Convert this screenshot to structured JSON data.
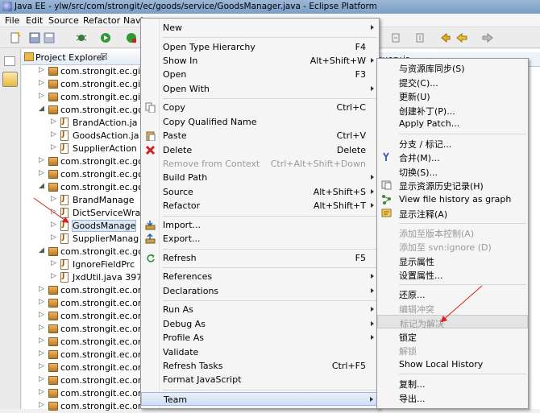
{
  "window": {
    "title": "Java EE - ylw/src/com/strongit/ec/goods/service/GoodsManager.java - Eclipse Platform"
  },
  "menubar": [
    "File",
    "Edit",
    "Source",
    "Refactor",
    "Navi"
  ],
  "explorer": {
    "tab_label": "Project Explorer",
    "tab_close": "☒",
    "rows": [
      {
        "label": "com.strongit.ec.gi",
        "kind": "pkg",
        "arrow": "▷"
      },
      {
        "label": "com.strongit.ec.gi",
        "kind": "pkg",
        "arrow": "▷"
      },
      {
        "label": "com.strongit.ec.gi",
        "kind": "pkg",
        "arrow": "▷"
      },
      {
        "label": "com.strongit.ec.gc",
        "kind": "pkg",
        "arrow": "◢"
      },
      {
        "label": "BrandAction.ja",
        "kind": "java",
        "arrow": "▷"
      },
      {
        "label": "GoodsAction.ja",
        "kind": "java",
        "arrow": "▷"
      },
      {
        "label": "SupplierAction",
        "kind": "java",
        "arrow": "▷"
      },
      {
        "label": "com.strongit.ec.gc",
        "kind": "pkg",
        "arrow": "▷"
      },
      {
        "label": "com.strongit.ec.gc",
        "kind": "pkg",
        "arrow": "▷"
      },
      {
        "label": "com.strongit.ec.gc",
        "kind": "pkg",
        "arrow": "◢"
      },
      {
        "label": "BrandManage",
        "kind": "java",
        "arrow": "▷"
      },
      {
        "label": "DictServiceWra",
        "kind": "java",
        "arrow": "▷"
      },
      {
        "label": "GoodsManage",
        "kind": "java",
        "arrow": "▷",
        "selected": true
      },
      {
        "label": "SupplierManag",
        "kind": "java",
        "arrow": "▷"
      },
      {
        "label": "com.strongit.ec.gc",
        "kind": "pkg",
        "arrow": "◢"
      },
      {
        "label": "IgnoreFieldPrc",
        "kind": "java",
        "arrow": "▷"
      },
      {
        "label": "JxdUtil.java 397",
        "kind": "java",
        "arrow": "▷"
      },
      {
        "label": "com.strongit.ec.or",
        "kind": "pkg",
        "arrow": "▷"
      },
      {
        "label": "com.strongit.ec.or",
        "kind": "pkg",
        "arrow": "▷"
      },
      {
        "label": "com.strongit.ec.or",
        "kind": "pkg",
        "arrow": "▷"
      },
      {
        "label": "com.strongit.ec.or",
        "kind": "pkg",
        "arrow": "▷"
      },
      {
        "label": "com.strongit.ec.or",
        "kind": "pkg",
        "arrow": "▷"
      },
      {
        "label": "com.strongit.ec.or",
        "kind": "pkg",
        "arrow": "▷"
      },
      {
        "label": "com.strongit.ec.or",
        "kind": "pkg",
        "arrow": "▷"
      },
      {
        "label": "com.strongit.ec.or",
        "kind": "pkg",
        "arrow": "▷"
      },
      {
        "label": "com.strongit.ec.or",
        "kind": "pkg",
        "arrow": "▷"
      },
      {
        "label": "com.strongit.ec.or",
        "kind": "pkg",
        "arrow": "▷"
      }
    ]
  },
  "editor": {
    "tab_label": "iquery.js"
  },
  "context_menu": {
    "items": [
      {
        "label": "New",
        "shortcut": "",
        "submenu": true
      },
      {
        "sep": true
      },
      {
        "label": "Open Type Hierarchy",
        "shortcut": "F4"
      },
      {
        "label": "Show In",
        "shortcut": "Alt+Shift+W",
        "submenu": true
      },
      {
        "label": "Open",
        "shortcut": "F3"
      },
      {
        "label": "Open With",
        "shortcut": "",
        "submenu": true
      },
      {
        "sep": true
      },
      {
        "label": "Copy",
        "shortcut": "Ctrl+C",
        "icon": "copy-icon"
      },
      {
        "label": "Copy Qualified Name",
        "shortcut": ""
      },
      {
        "label": "Paste",
        "shortcut": "Ctrl+V",
        "icon": "paste-icon"
      },
      {
        "label": "Delete",
        "shortcut": "Delete",
        "icon": "delete-icon"
      },
      {
        "label": "Remove from Context",
        "shortcut": "Ctrl+Alt+Shift+Down",
        "disabled": true
      },
      {
        "label": "Build Path",
        "shortcut": "",
        "submenu": true
      },
      {
        "label": "Source",
        "shortcut": "Alt+Shift+S",
        "submenu": true
      },
      {
        "label": "Refactor",
        "shortcut": "Alt+Shift+T",
        "submenu": true
      },
      {
        "sep": true
      },
      {
        "label": "Import...",
        "shortcut": "",
        "icon": "import-icon"
      },
      {
        "label": "Export...",
        "shortcut": "",
        "icon": "export-icon"
      },
      {
        "sep": true
      },
      {
        "label": "Refresh",
        "shortcut": "F5",
        "icon": "refresh-icon"
      },
      {
        "sep": true
      },
      {
        "label": "References",
        "shortcut": "",
        "submenu": true
      },
      {
        "label": "Declarations",
        "shortcut": "",
        "submenu": true
      },
      {
        "sep": true
      },
      {
        "label": "Run As",
        "shortcut": "",
        "submenu": true
      },
      {
        "label": "Debug As",
        "shortcut": "",
        "submenu": true
      },
      {
        "label": "Profile As",
        "shortcut": "",
        "submenu": true
      },
      {
        "label": "Validate",
        "shortcut": ""
      },
      {
        "label": "Refresh Tasks",
        "shortcut": "Ctrl+F5"
      },
      {
        "label": "Format JavaScript",
        "shortcut": ""
      },
      {
        "sep": true
      },
      {
        "label": "Team",
        "shortcut": "",
        "submenu": true,
        "highlight": true
      }
    ]
  },
  "team_menu": {
    "items": [
      {
        "label": "与资源库同步(S)"
      },
      {
        "label": "提交(C)..."
      },
      {
        "label": "更新(U)"
      },
      {
        "label": "创建补丁(P)..."
      },
      {
        "label": "Apply Patch..."
      },
      {
        "sep": true
      },
      {
        "label": "分支 / 标记..."
      },
      {
        "label": "合并(M)...",
        "icon": "merge-icon"
      },
      {
        "label": "切换(S)..."
      },
      {
        "label": "显示资源历史记录(H)",
        "icon": "history-icon"
      },
      {
        "label": "View file history as graph",
        "icon": "graph-icon"
      },
      {
        "label": "显示注释(A)",
        "icon": "annotate-icon"
      },
      {
        "sep": true
      },
      {
        "label": "添加至版本控制(A)",
        "disabled": true
      },
      {
        "label": "添加至 svn:ignore (D)",
        "disabled": true
      },
      {
        "label": "显示属性"
      },
      {
        "label": "设置属性..."
      },
      {
        "sep": true
      },
      {
        "label": "还原..."
      },
      {
        "label": "编辑冲突",
        "disabled": true
      },
      {
        "label": "标记为解决",
        "disabled": true,
        "hover": true
      },
      {
        "label": "锁定"
      },
      {
        "label": "解锁",
        "disabled": true
      },
      {
        "label": "Show Local History"
      },
      {
        "sep": true
      },
      {
        "label": "复制..."
      },
      {
        "label": "导出..."
      }
    ]
  }
}
